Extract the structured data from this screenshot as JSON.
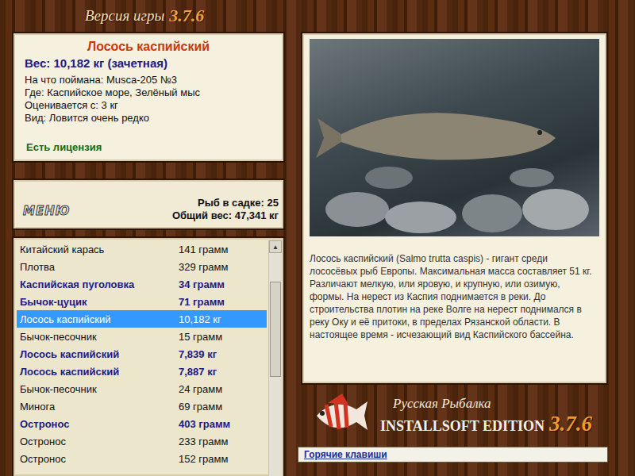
{
  "version": {
    "label": "Версия игры",
    "number": "3.7.6"
  },
  "fish": {
    "name": "Лосось каспийский",
    "weight": "Вес: 10,182 кг (зачетная)",
    "details": [
      "На что поймана: Musca-205 №3",
      "Где: Каспийское море, Зелёный мыс",
      "Оценивается с: 3 кг",
      "Вид: Ловится очень редко"
    ],
    "license": "Есть лицензия",
    "description": "Лосось каспийский (Salmo trutta caspis) - гигант среди лососёвых рыб Европы. Максимальная масса составляет 51 кг. Различают мелкую, или яровую, и крупную, или озимую, формы. На нерест из Каспия поднимается в реки. До строительства плотин на реке Волге на нерест поднимался в реку Оку и её притоки, в пределах Рязанской области. В настоящее время - исчезающий вид Каспийского бассейна."
  },
  "menu_button": "МЕНЮ",
  "keepnet": {
    "count": "Рыб в садке: 25",
    "total": "Общий вес: 47,341 кг"
  },
  "catch_list": {
    "scroll_position": 0.2,
    "rows": [
      {
        "name": "Китайский карась",
        "weight": "141 грамм",
        "selected": false,
        "emphasized": false
      },
      {
        "name": "Плотва",
        "weight": "329 грамм",
        "selected": false,
        "emphasized": false
      },
      {
        "name": "Каспийская пуголовка",
        "weight": "34 грамм",
        "selected": false,
        "emphasized": true
      },
      {
        "name": "Бычок-цуцик",
        "weight": "71 грамм",
        "selected": false,
        "emphasized": true
      },
      {
        "name": "Лосось каспийский",
        "weight": "10,182 кг",
        "selected": true,
        "emphasized": false
      },
      {
        "name": "Бычок-песочник",
        "weight": "15 грамм",
        "selected": false,
        "emphasized": false
      },
      {
        "name": "Лосось каспийский",
        "weight": "7,839 кг",
        "selected": false,
        "emphasized": true
      },
      {
        "name": "Лосось каспийский",
        "weight": "7,887 кг",
        "selected": false,
        "emphasized": true
      },
      {
        "name": "Бычок-песочник",
        "weight": "24 грамм",
        "selected": false,
        "emphasized": false
      },
      {
        "name": "Минога",
        "weight": "69 грамм",
        "selected": false,
        "emphasized": false
      },
      {
        "name": "Остронос",
        "weight": "403 грамм",
        "selected": false,
        "emphasized": true
      },
      {
        "name": "Остронос",
        "weight": "233 грамм",
        "selected": false,
        "emphasized": false
      },
      {
        "name": "Остронос",
        "weight": "152 грамм",
        "selected": false,
        "emphasized": false
      }
    ]
  },
  "logo": {
    "title": "Русская Рыбалка",
    "edition": "INSTALLSOFT EDITION",
    "number": "3.7.6"
  },
  "hotkeys_button": "Горячие клавиши"
}
